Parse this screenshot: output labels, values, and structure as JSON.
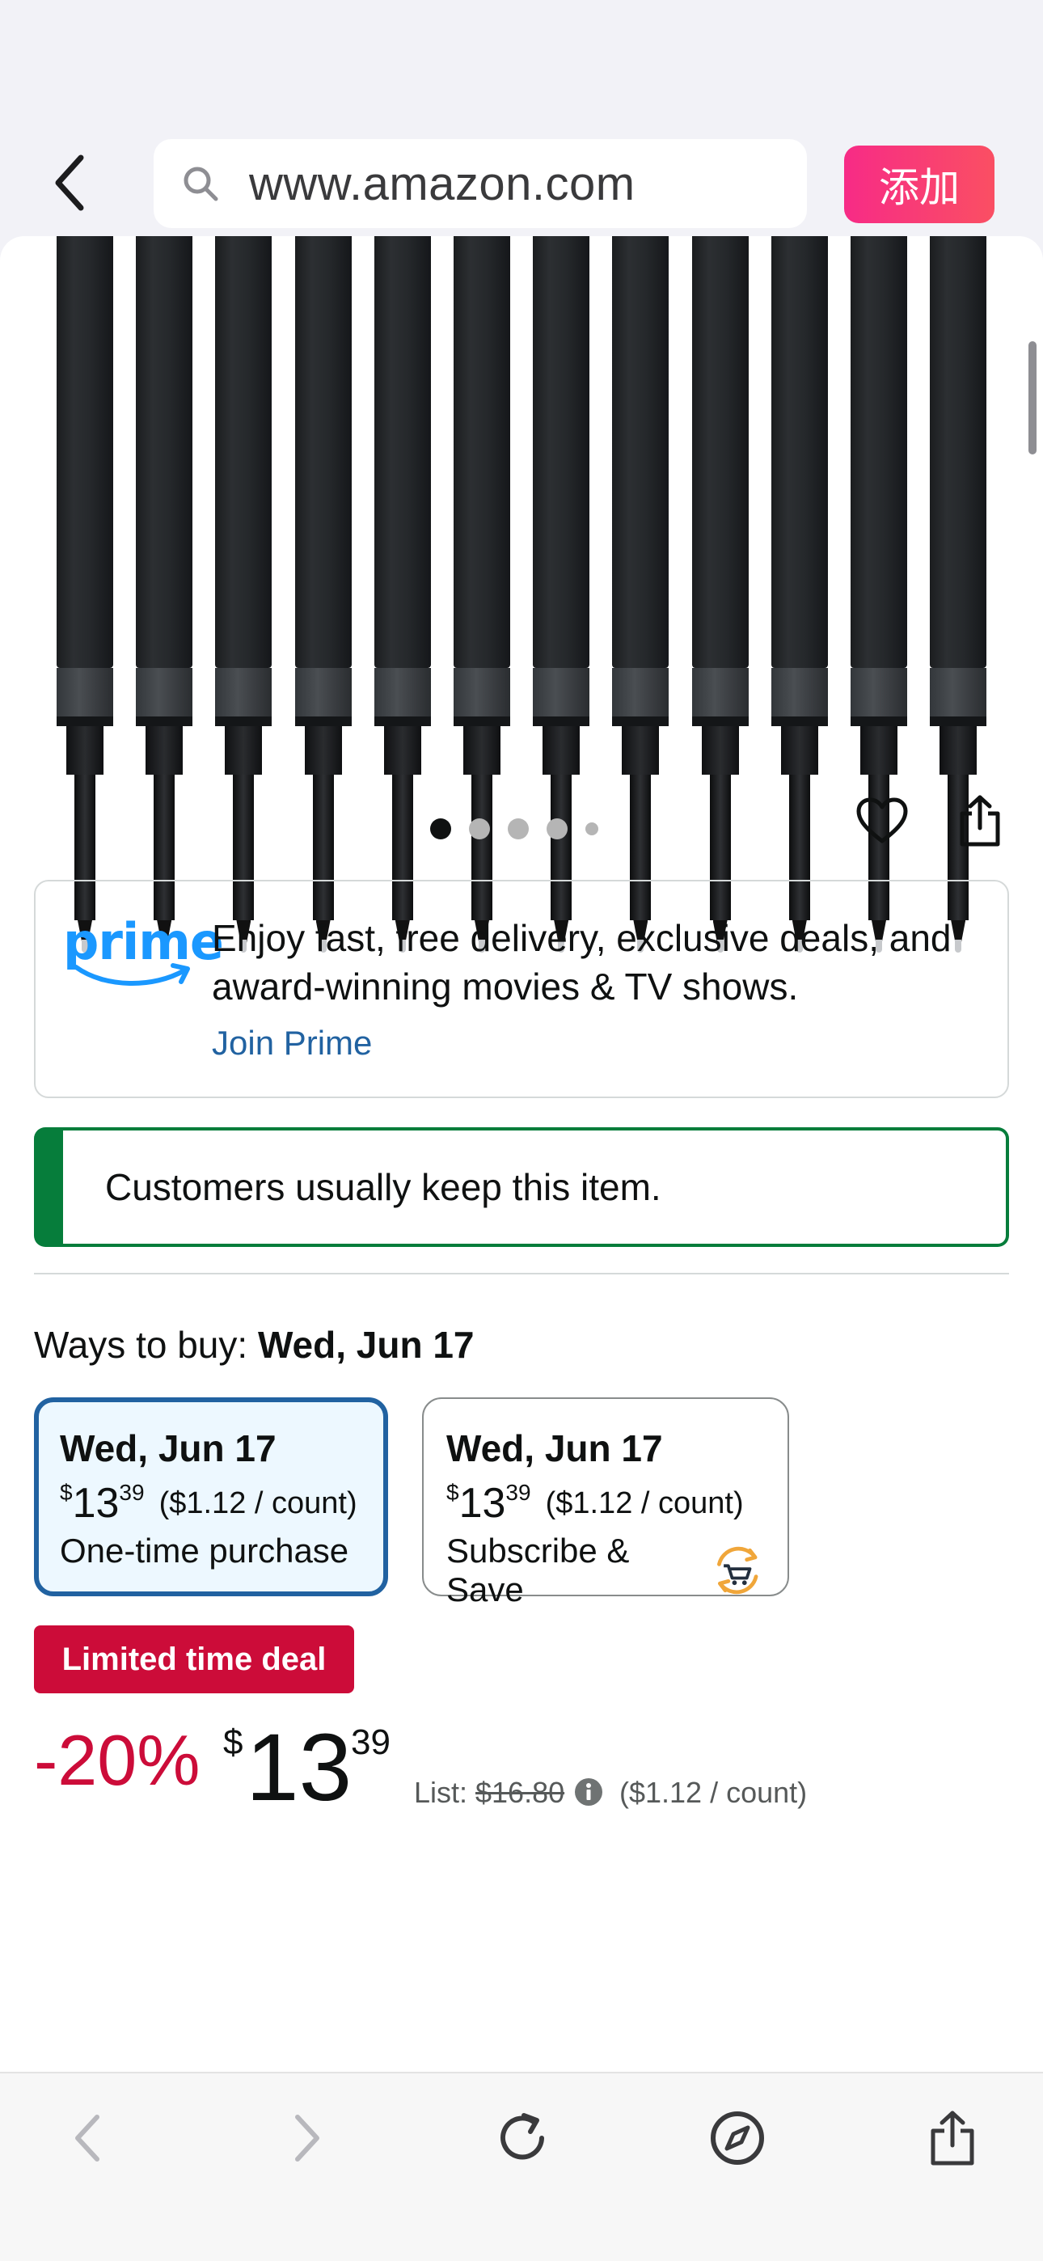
{
  "browser": {
    "url": "www.amazon.com",
    "add_button_label": "添加"
  },
  "gallery": {
    "refill_count": 12,
    "dot_count": 5,
    "active_dot": 0
  },
  "prime": {
    "logo_text": "prime",
    "message": "Enjoy fast, free delivery, exclusive deals, and award-winning movies & TV shows.",
    "join_label": "Join Prime",
    "logo_color": "#1a98ff",
    "link_color": "#2162a1"
  },
  "keep_notice": {
    "text": "Customers usually keep this item.",
    "accent_color": "#067d3b"
  },
  "ways_to_buy": {
    "label": "Ways to buy: ",
    "date": "Wed, Jun 17",
    "options": [
      {
        "date": "Wed, Jun 17",
        "currency": "$",
        "whole": "13",
        "fraction": "39",
        "unit_price": "($1.12 / count)",
        "type": "One-time purchase",
        "selected": true
      },
      {
        "date": "Wed, Jun 17",
        "currency": "$",
        "whole": "13",
        "fraction": "39",
        "unit_price": "($1.12 / count)",
        "type": "Subscribe & Save",
        "selected": false,
        "icon": "subscribe-save-cart-icon"
      }
    ]
  },
  "deal": {
    "badge": "Limited time deal",
    "discount": "-20%",
    "currency": "$",
    "whole": "13",
    "fraction": "39",
    "list_label": "List: ",
    "list_price": "$16.80",
    "unit_price": "($1.12 / count)",
    "badge_color": "#cc0c39"
  },
  "toolbar": {
    "icons": [
      "back-arrow-icon",
      "forward-arrow-icon",
      "reload-icon",
      "compass-icon",
      "share-icon"
    ]
  }
}
